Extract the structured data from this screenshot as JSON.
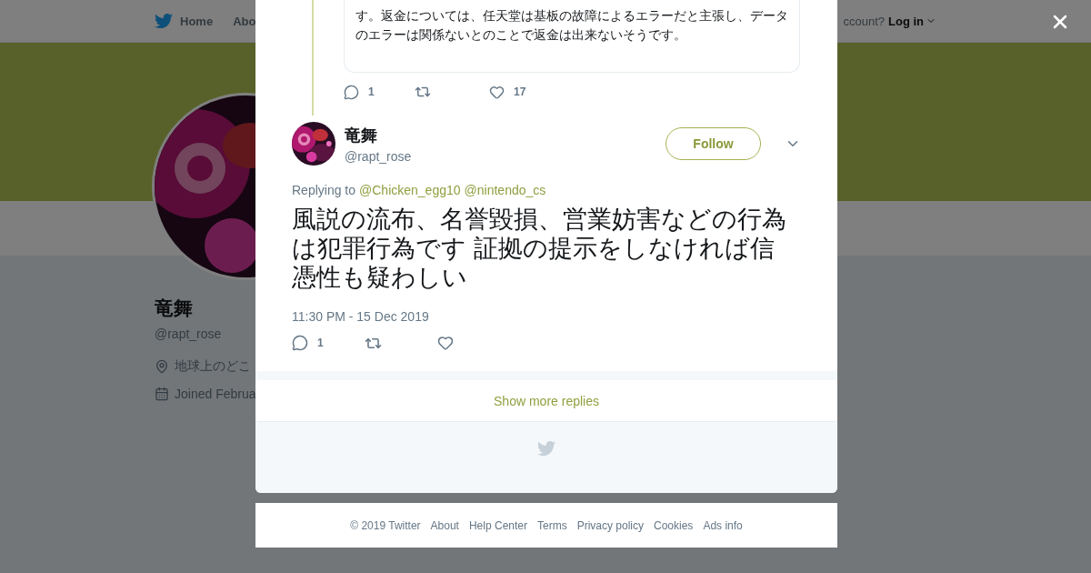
{
  "background": {
    "nav": {
      "home": "Home",
      "about": "Abo",
      "account_prompt": "ccount?",
      "login": "Log in"
    },
    "profile": {
      "name": "竜舞",
      "handle": "@rapt_rose",
      "location": "地球上のどこ",
      "joined": "Joined Februa"
    }
  },
  "quoted_tweet": {
    "text_lines": [
      "す。返金については、任天堂は基板の故障によるエラーだと主張し、データ",
      "のエラーは関係ないとのことで返金は出来ないそうです。"
    ],
    "reply_count": "1",
    "like_count": "17"
  },
  "tweet": {
    "name": "竜舞",
    "handle": "@rapt_rose",
    "follow_label": "Follow",
    "replying_label": "Replying to",
    "mentions": [
      "@Chicken_egg10",
      "@nintendo_cs"
    ],
    "text": "風説の流布、名誉毀損、営業妨害などの行為は犯罪行為です 証拠の提示をしなければ信憑性も疑わしい",
    "timestamp": "11:30 PM - 15 Dec 2019",
    "reply_count": "1"
  },
  "show_more": "Show more replies",
  "footer": [
    "© 2019 Twitter",
    "About",
    "Help Center",
    "Terms",
    "Privacy policy",
    "Cookies",
    "Ads info"
  ]
}
